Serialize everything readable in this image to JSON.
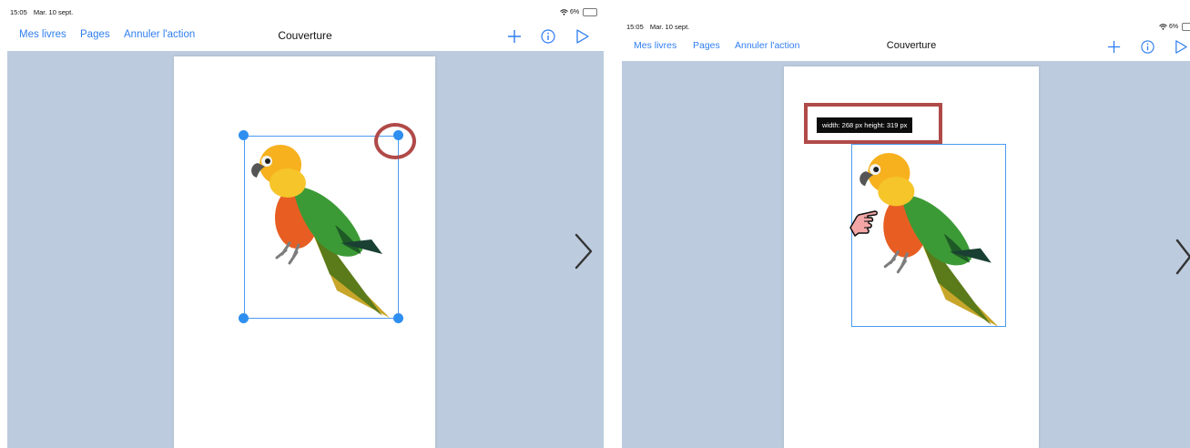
{
  "status_bar": {
    "time": "15:05",
    "date": "Mar. 10 sept.",
    "battery": "6%"
  },
  "nav": {
    "my_books": "Mes livres",
    "pages": "Pages",
    "undo": "Annuler l'action",
    "title": "Couverture"
  },
  "icons": {
    "add": "plus-icon",
    "info": "info-icon",
    "play": "play-icon",
    "next": "chevron-right-icon",
    "pointer": "hand-pointer-icon"
  },
  "tooltip": {
    "text": "width: 268 px height: 319 px"
  },
  "colors": {
    "accent": "#2f7ef0",
    "canvas": "#bccbdd",
    "selection": "#4a9af2",
    "highlight": "#b04a48"
  }
}
